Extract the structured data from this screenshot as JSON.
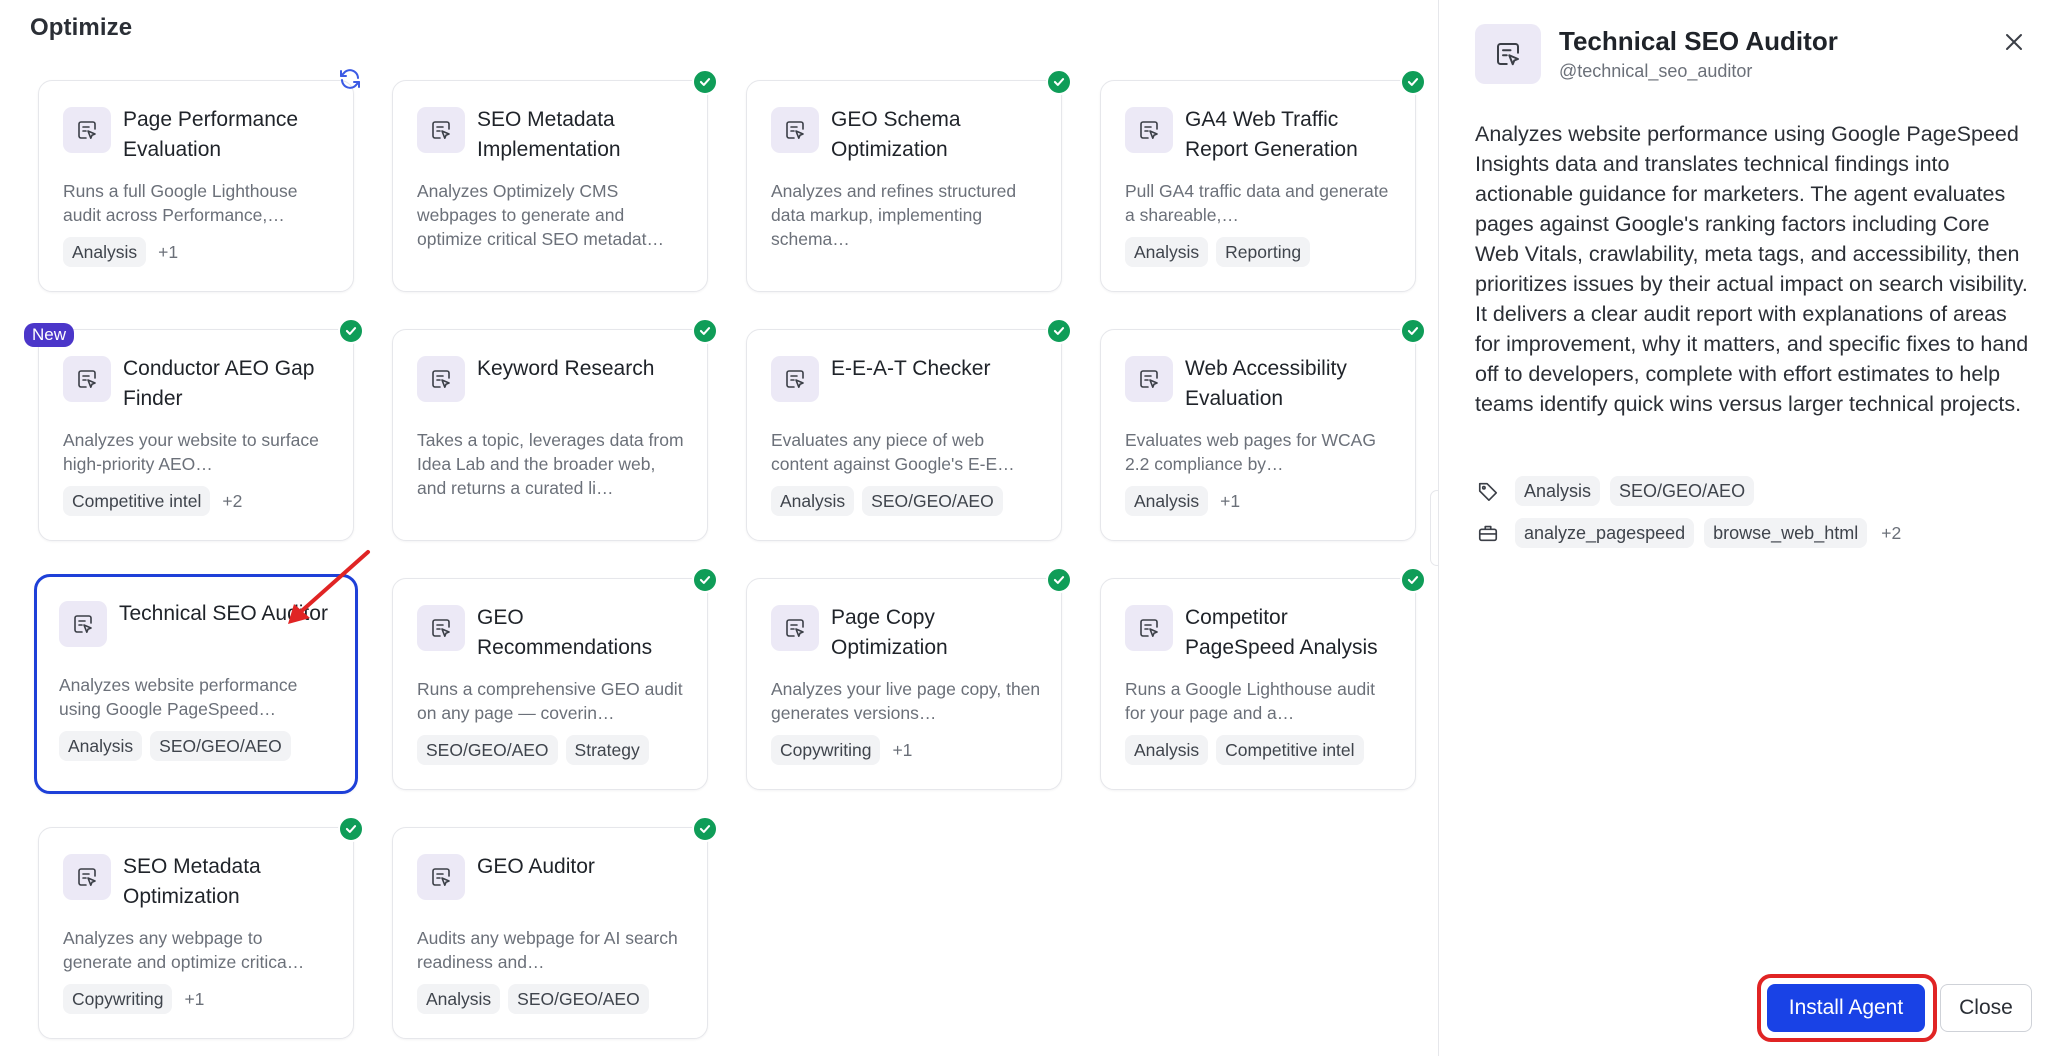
{
  "section": {
    "title": "Optimize"
  },
  "cards": [
    {
      "title": "Page Performance Evaluation",
      "desc": "Runs a full Google Lighthouse audit across Performance,…",
      "tags": [
        "Analysis"
      ],
      "more": "+1"
    },
    {
      "title": "SEO Metadata Implementation",
      "desc": "Analyzes Optimizely CMS webpages to generate and optimize critical SEO metadat…",
      "tags": [],
      "more": ""
    },
    {
      "title": "GEO Schema Optimization",
      "desc": "Analyzes and refines structured data markup, implementing schema…",
      "tags": [],
      "more": ""
    },
    {
      "title": "GA4 Web Traffic Report Generation",
      "desc": "Pull GA4 traffic data and generate a shareable,…",
      "tags": [
        "Analysis",
        "Reporting"
      ],
      "more": ""
    },
    {
      "title": "Conductor AEO Gap Finder",
      "desc": "Analyzes your website to surface high-priority AEO…",
      "tags": [
        "Competitive intel"
      ],
      "more": "+2"
    },
    {
      "title": "Keyword Research",
      "desc": "Takes a topic, leverages data from Idea Lab and the broader web, and returns a curated li…",
      "tags": [],
      "more": ""
    },
    {
      "title": "E-E-A-T Checker",
      "desc": "Evaluates any piece of web content against Google's E-E…",
      "tags": [
        "Analysis",
        "SEO/GEO/AEO"
      ],
      "more": ""
    },
    {
      "title": "Web Accessibility Evaluation",
      "desc": "Evaluates web pages for WCAG 2.2 compliance by…",
      "tags": [
        "Analysis"
      ],
      "more": "+1"
    },
    {
      "title": "Technical SEO Auditor",
      "desc": "Analyzes website performance using Google PageSpeed…",
      "tags": [
        "Analysis",
        "SEO/GEO/AEO"
      ],
      "more": ""
    },
    {
      "title": "GEO Recommendations",
      "desc": "Runs a comprehensive GEO audit on any page — coverin…",
      "tags": [
        "SEO/GEO/AEO",
        "Strategy"
      ],
      "more": ""
    },
    {
      "title": "Page Copy Optimization",
      "desc": "Analyzes your live page copy, then generates versions…",
      "tags": [
        "Copywriting"
      ],
      "more": "+1"
    },
    {
      "title": "Competitor PageSpeed Analysis",
      "desc": "Runs a Google Lighthouse audit for your page and a…",
      "tags": [
        "Analysis",
        "Competitive intel"
      ],
      "more": ""
    },
    {
      "title": "SEO Metadata Optimization",
      "desc": "Analyzes any webpage to generate and optimize critica…",
      "tags": [
        "Copywriting"
      ],
      "more": "+1"
    },
    {
      "title": "GEO Auditor",
      "desc": "Audits any webpage for AI search readiness and…",
      "tags": [
        "Analysis",
        "SEO/GEO/AEO"
      ],
      "more": ""
    }
  ],
  "badges": {
    "new": "New"
  },
  "panel": {
    "title": "Technical SEO Auditor",
    "handle": "@technical_seo_auditor",
    "description": "Analyzes website performance using Google PageSpeed Insights data and translates technical findings into actionable guidance for marketers. The agent evaluates pages against Google's ranking factors including Core Web Vitals, crawlability, meta tags, and accessibility, then prioritizes issues by their actual impact on search visibility. It delivers a clear audit report with explanations of areas for improvement, why it matters, and specific fixes to hand off to developers, complete with effort estimates to help teams identify quick wins versus larger technical projects.",
    "categories": [
      "Analysis",
      "SEO/GEO/AEO"
    ],
    "tools": [
      "analyze_pagespeed",
      "browse_web_html"
    ],
    "tools_more": "+2",
    "install_label": "Install Agent",
    "close_label": "Close"
  },
  "colors": {
    "accent": "#1942e6",
    "check": "#0f9d58",
    "new_badge": "#4b36c9",
    "highlight": "#e02424"
  },
  "icons": {
    "agent": "agent-cursor-icon",
    "check": "check-circle-icon",
    "refresh": "refresh-icon",
    "tag": "tag-icon",
    "tools": "toolbox-icon",
    "close": "close-icon"
  }
}
